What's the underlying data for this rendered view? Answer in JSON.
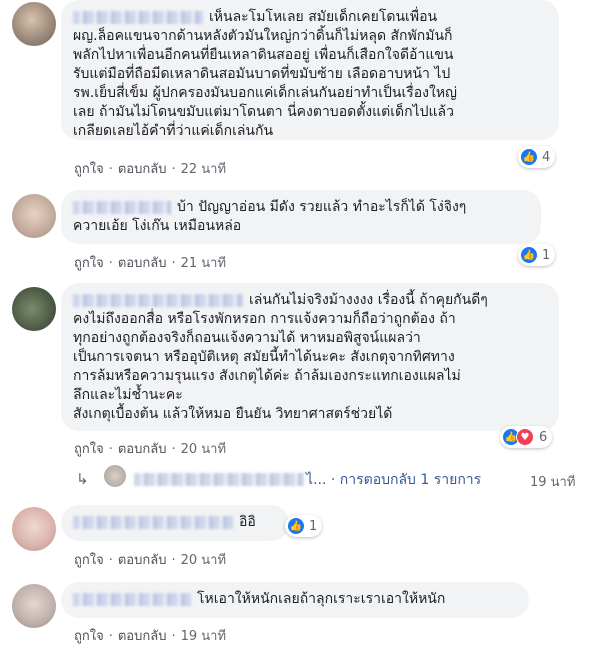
{
  "comments": [
    {
      "lines": [
        "เห็นละโมโหเลย สมัยเด็กเคยโดนเพื่อน",
        "ผญ.ล็อคแขนจากด้านหลังตัวมันใหญ่กว่าดิ้นก็ไม่หลุด สักพักมันก็",
        "พลักไปหาเพื่อนอีกคนที่ยืนเหลาดินสออยู่ เพื่อนก็เสือกใจดีอ้าแขน",
        "รับแต่มือที่ถือมีดเหลาดินสอมันบาดที่ขมับซ้าย เลือดอาบหน้า ไป",
        "รพ.เย็บสี่เข็ม ผู้ปกครองมันบอกแค่เด็กเล่นกันอย่าทำเป็นเรื่องใหญ่",
        "เลย ถ้ามันไม่โดนขมับแต่มาโดนตา นี่คงตาบอดตั้งแต่เด็กไปแล้ว",
        "เกลียดเลยไอ้คำที่ว่าแค่เด็กเล่นกัน"
      ],
      "like": "ถูกใจ",
      "reply": "ตอบกลับ",
      "time": "22 นาที",
      "reactions": "4"
    },
    {
      "lines": [
        "บ้า ปัญญาอ่อน มีดัง รวยแล้ว ทำอะไรก็ได้ โง่จิงๆ",
        "ควายเอ้ย โง่เก๊น เหมือนหล่อ"
      ],
      "like": "ถูกใจ",
      "reply": "ตอบกลับ",
      "time": "21 นาที",
      "reactions": "1"
    },
    {
      "lines": [
        "เล่นกันไม่จริงม้างงงง เรื่องนี้ ถ้าคุยกันดีๆ",
        "คงไม่ถึงออกสื่อ หรือโรงพักหรอก การแจ้งความก็ถือว่าถูกต้อง ถ้า",
        "ทุกอย่างถูกต้องจริงก็ถอนแจ้งความได้ หาหมอพิสูจน์แผลว่า",
        "เป็นการเจตนา หรืออุบัติเหตุ สมัยนี้ทำได้นะคะ สังเกตุจากทิศทาง",
        "การล้มหรือความรุนแรง สังเกตุได้ค่ะ ถ้าล้มเองกระแทกเองแผลไม่",
        "ลึกและไม่ช้ำนะคะ",
        "สังเกตุเบื้องต้น แล้วให้หมอ ยืนยัน วิทยาศาสตร์ช่วยได้"
      ],
      "like": "ถูกใจ",
      "reply": "ตอบกลับ",
      "time": "20 นาที",
      "reactions": "6",
      "replies_link": "ไ... · การตอบกลับ 1 รายการ",
      "replies_time": "19 นาที"
    },
    {
      "lines": [
        "อิอิ"
      ],
      "like": "ถูกใจ",
      "reply": "ตอบกลับ",
      "time": "20 นาที",
      "reactions": "1"
    },
    {
      "lines": [
        "โหเอาให้หนักเลยถ้าลุกเราะเราเอาให้หนัก"
      ],
      "like": "ถูกใจ",
      "reply": "ตอบกลับ",
      "time": "19 นาที"
    }
  ],
  "colors": {
    "bubble": "#f2f3f5",
    "like_blue": "#1877f2",
    "love_red": "#f33e58",
    "link": "#385898",
    "meta": "#606770"
  }
}
